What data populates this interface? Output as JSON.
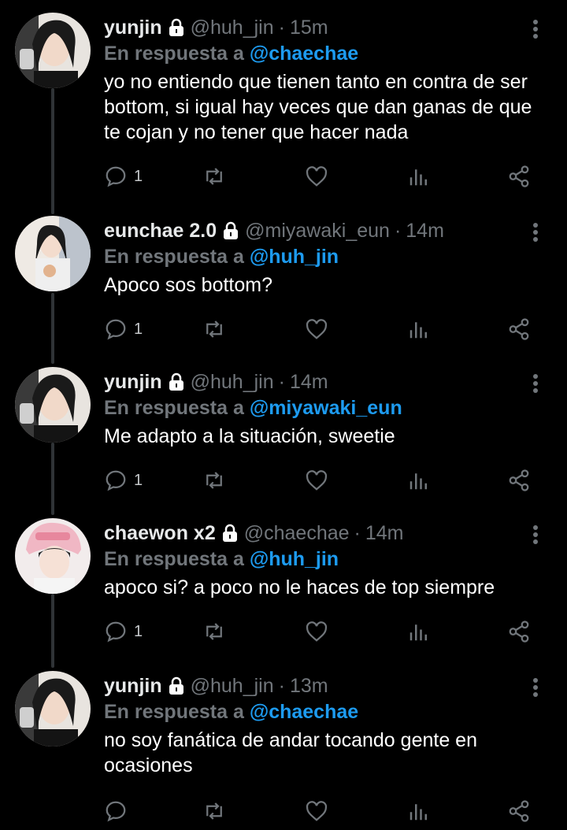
{
  "reply_prefix": "En respuesta a",
  "colors": {
    "background": "#000000",
    "secondary_text": "#71767b",
    "mention": "#1d9bf0",
    "thread_line": "#2f3336"
  },
  "tweets": [
    {
      "name": "yunjin",
      "handle": "@huh_jin",
      "separator": "·",
      "time": "15m",
      "reply_to": "@chaechae",
      "text": "yo no entiendo que tienen tanto en contra de ser bottom, si igual hay veces que dan ganas de que te cojan y no tener que hacer nada",
      "reply_count": "1",
      "avatar": "yunjin-avatar"
    },
    {
      "name": "eunchae 2.0",
      "handle": "@miyawaki_eun",
      "separator": "·",
      "time": "14m",
      "reply_to": "@huh_jin",
      "text": "Apoco sos bottom?",
      "reply_count": "1",
      "avatar": "eunchae-avatar"
    },
    {
      "name": "yunjin",
      "handle": "@huh_jin",
      "separator": "·",
      "time": "14m",
      "reply_to": "@miyawaki_eun",
      "text": "Me adapto a la situación, sweetie",
      "reply_count": "1",
      "avatar": "yunjin-avatar"
    },
    {
      "name": "chaewon x2",
      "handle": "@chaechae",
      "separator": "·",
      "time": "14m",
      "reply_to": "@huh_jin",
      "text": "apoco si? a poco no le haces de top siempre",
      "reply_count": "1",
      "avatar": "chaewon-avatar"
    },
    {
      "name": "yunjin",
      "handle": "@huh_jin",
      "separator": "·",
      "time": "13m",
      "reply_to": "@chaechae",
      "text": "no soy fanática de andar tocando gente en ocasiones",
      "reply_count": "",
      "avatar": "yunjin-avatar"
    }
  ]
}
